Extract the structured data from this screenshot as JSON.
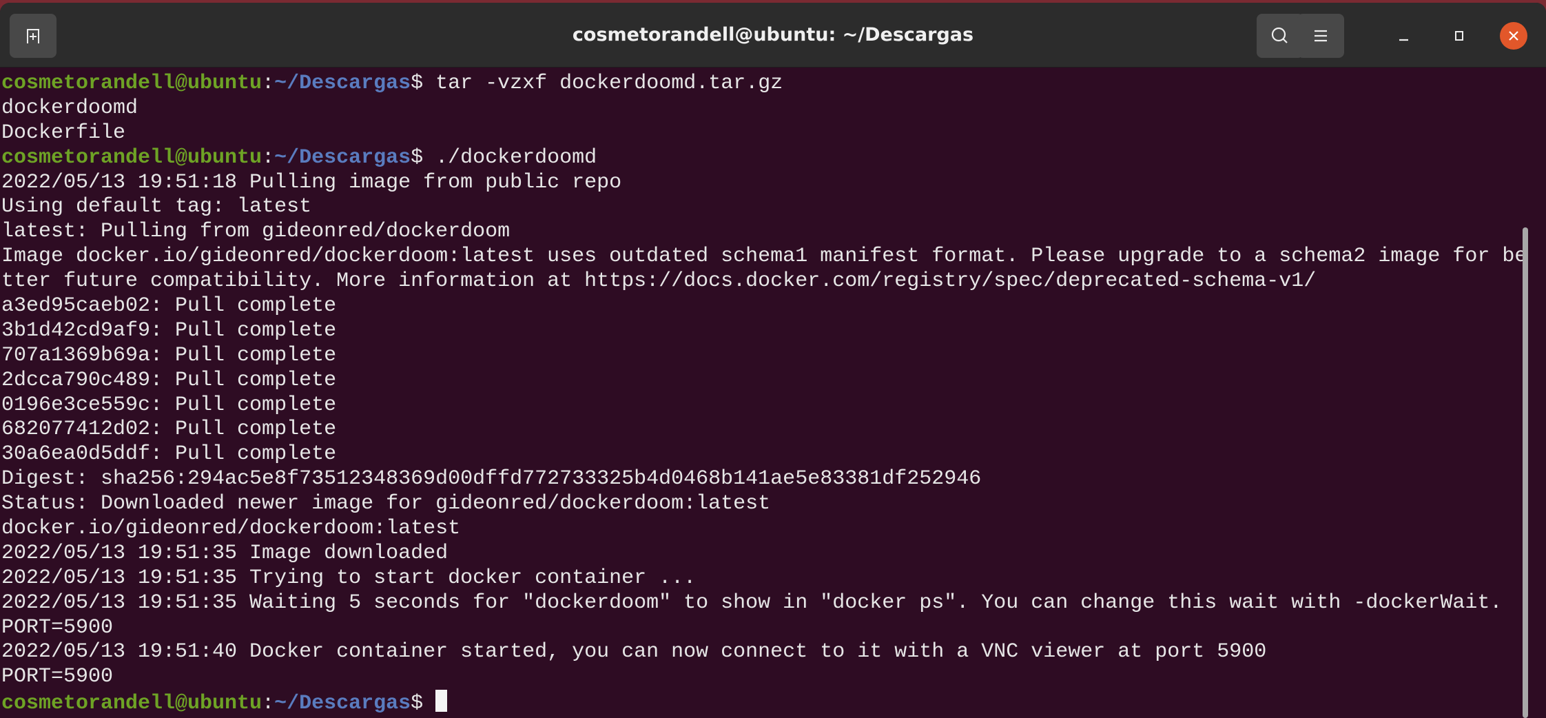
{
  "window": {
    "title": "cosmetorandell@ubuntu: ~/Descargas"
  },
  "titlebar": {
    "new_tab_icon": "new-tab-icon",
    "search_icon": "search-icon",
    "menu_icon": "hamburger-menu-icon",
    "minimize_icon": "minimize-icon",
    "maximize_icon": "maximize-icon",
    "close_icon": "close-icon",
    "close_color": "#e2572a"
  },
  "prompt": {
    "user": "cosmetorandell@ubuntu",
    "sep": ":",
    "path": "~/Descargas",
    "symbol": "$ "
  },
  "colors": {
    "background": "#2e0c23",
    "user": "#6ea325",
    "path": "#5a7cbf",
    "text": "#e6e6e6"
  },
  "lines": [
    {
      "prompt": true,
      "text": "tar -vzxf dockerdoomd.tar.gz"
    },
    {
      "text": "dockerdoomd"
    },
    {
      "text": "Dockerfile"
    },
    {
      "prompt": true,
      "text": "./dockerdoomd"
    },
    {
      "text": "2022/05/13 19:51:18 Pulling image from public repo"
    },
    {
      "text": "Using default tag: latest"
    },
    {
      "text": "latest: Pulling from gideonred/dockerdoom"
    },
    {
      "text": "Image docker.io/gideonred/dockerdoom:latest uses outdated schema1 manifest format. Please upgrade to a schema2 image for be"
    },
    {
      "text": "tter future compatibility. More information at https://docs.docker.com/registry/spec/deprecated-schema-v1/"
    },
    {
      "text": "a3ed95caeb02: Pull complete"
    },
    {
      "text": "3b1d42cd9af9: Pull complete"
    },
    {
      "text": "707a1369b69a: Pull complete"
    },
    {
      "text": "2dcca790c489: Pull complete"
    },
    {
      "text": "0196e3ce559c: Pull complete"
    },
    {
      "text": "682077412d02: Pull complete"
    },
    {
      "text": "30a6ea0d5ddf: Pull complete"
    },
    {
      "text": "Digest: sha256:294ac5e8f73512348369d00dffd772733325b4d0468b141ae5e83381df252946"
    },
    {
      "text": "Status: Downloaded newer image for gideonred/dockerdoom:latest"
    },
    {
      "text": "docker.io/gideonred/dockerdoom:latest"
    },
    {
      "text": "2022/05/13 19:51:35 Image downloaded"
    },
    {
      "text": "2022/05/13 19:51:35 Trying to start docker container ..."
    },
    {
      "text": "2022/05/13 19:51:35 Waiting 5 seconds for \"dockerdoom\" to show in \"docker ps\". You can change this wait with -dockerWait."
    },
    {
      "text": "PORT=5900"
    },
    {
      "text": "2022/05/13 19:51:40 Docker container started, you can now connect to it with a VNC viewer at port 5900"
    },
    {
      "text": "PORT=5900"
    },
    {
      "prompt": true,
      "text": "",
      "cursor": true
    }
  ]
}
